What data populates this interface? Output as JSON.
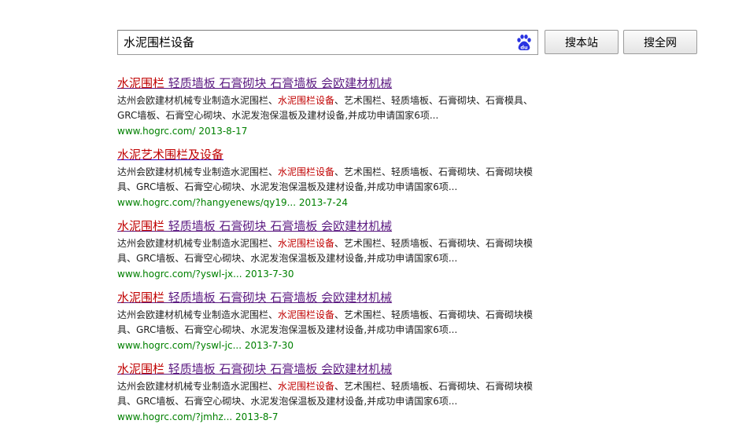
{
  "search": {
    "query": "水泥围栏设备",
    "site_button": "搜本站",
    "web_button": "搜全网"
  },
  "results": [
    {
      "title_parts": [
        "水泥围栏",
        " 轻质墙板 石膏砌块 石膏墙板 会欧建材机械"
      ],
      "visited": true,
      "abstract_parts": [
        "达州会欧建材机械专业制造水泥围栏、",
        "水泥围栏设备",
        "、艺术围栏、轻质墙板、石膏砌块、石膏模具、GRC墙板、石膏空心砌块、水泥发泡保温板及建材设备,并成功申请国家6项..."
      ],
      "url": "www.hogrc.com/",
      "date": "2013-8-17"
    },
    {
      "title_parts": [
        "水泥",
        "艺术围栏及设备"
      ],
      "visited": false,
      "abstract_parts": [
        "达州会欧建材机械专业制造水泥围栏、",
        "水泥围栏设备",
        "、艺术围栏、轻质墙板、石膏砌块、石膏砌块模具、GRC墙板、石膏空心砌块、水泥发泡保温板及建材设备,并成功申请国家6项..."
      ],
      "url": "www.hogrc.com/?hangyenews/qy19...",
      "date": "2013-7-24"
    },
    {
      "title_parts": [
        "水泥围栏",
        " 轻质墙板 石膏砌块 石膏墙板 会欧建材机械"
      ],
      "visited": true,
      "abstract_parts": [
        "达州会欧建材机械专业制造水泥围栏、",
        "水泥围栏设备",
        "、艺术围栏、轻质墙板、石膏砌块、石膏砌块模具、GRC墙板、石膏空心砌块、水泥发泡保温板及建材设备,并成功申请国家6项..."
      ],
      "url": "www.hogrc.com/?yswl-jx...",
      "date": "2013-7-30"
    },
    {
      "title_parts": [
        "水泥围栏",
        " 轻质墙板 石膏砌块 石膏墙板 会欧建材机械"
      ],
      "visited": true,
      "abstract_parts": [
        "达州会欧建材机械专业制造水泥围栏、",
        "水泥围栏设备",
        "、艺术围栏、轻质墙板、石膏砌块、石膏砌块模具、GRC墙板、石膏空心砌块、水泥发泡保温板及建材设备,并成功申请国家6项..."
      ],
      "url": "www.hogrc.com/?yswl-jc...",
      "date": "2013-7-30"
    },
    {
      "title_parts": [
        "水泥围栏",
        " 轻质墙板 石膏砌块 石膏墙板 会欧建材机械"
      ],
      "visited": true,
      "abstract_parts": [
        "达州会欧建材机械专业制造水泥围栏、",
        "水泥围栏设备",
        "、艺术围栏、轻质墙板、石膏砌块、石膏砌块模具、GRC墙板、石膏空心砌块、水泥发泡保温板及建材设备,并成功申请国家6项..."
      ],
      "url": "www.hogrc.com/?jmhz...",
      "date": "2013-8-7"
    }
  ],
  "colors": {
    "link": "#2a00c8",
    "visited": "#5c1b82",
    "highlight": "#c00000",
    "url": "#008000",
    "baidu_blue": "#2932e1"
  },
  "icons": {
    "search_box_icon": "baidu-paw-icon"
  }
}
